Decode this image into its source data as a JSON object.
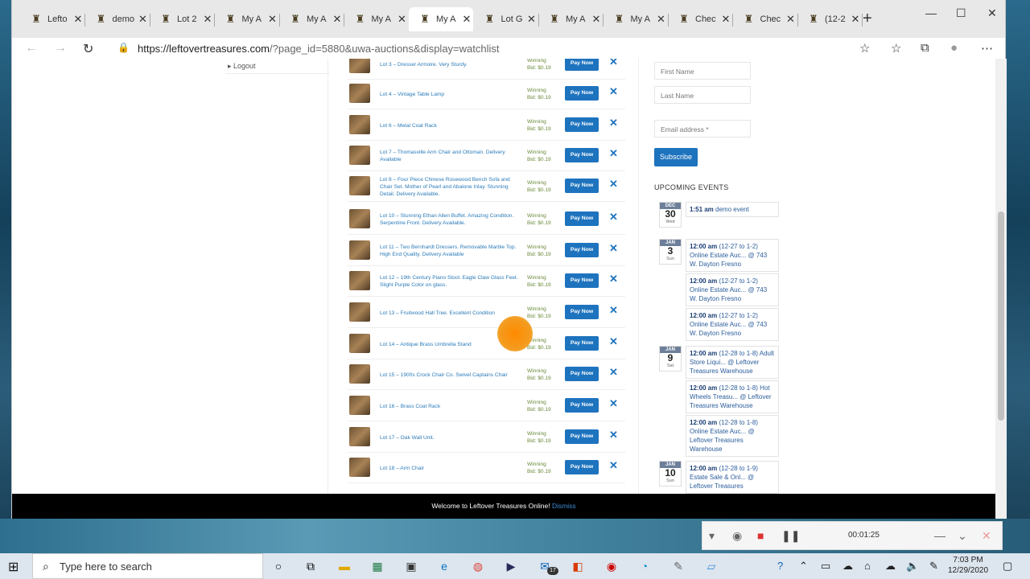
{
  "browser": {
    "tabs": [
      {
        "label": "Lefto",
        "active": false
      },
      {
        "label": "demo",
        "active": false
      },
      {
        "label": "Lot 2",
        "active": false
      },
      {
        "label": "My A",
        "active": false
      },
      {
        "label": "My A",
        "active": false
      },
      {
        "label": "My A",
        "active": false
      },
      {
        "label": "My A",
        "active": true
      },
      {
        "label": "Lot G",
        "active": false
      },
      {
        "label": "My A",
        "active": false
      },
      {
        "label": "My A",
        "active": false
      },
      {
        "label": "Chec",
        "active": false
      },
      {
        "label": "Chec",
        "active": false
      },
      {
        "label": "(12-2",
        "active": false
      }
    ],
    "url_host": "https://leftovertreasures.com",
    "url_path": "/?page_id=5880&uwa-auctions&display=watchlist"
  },
  "sidebar": {
    "logout_label": "Logout"
  },
  "watchlist": {
    "status_label": "Winning",
    "bid_label": "Bid: $0.19",
    "pay_label": "Pay Now",
    "remove_icon": "close-icon",
    "items": [
      {
        "title": "Lot 3 – Dresser Armoire. Very Sturdy."
      },
      {
        "title": "Lot 4 – Vintage Table Lamp"
      },
      {
        "title": "Lot 6 – Metal Coat Rack"
      },
      {
        "title": "Lot 7 – Thomasville Arm Chair and Ottoman. Delivery Available"
      },
      {
        "title": "Lot 8 – Four Piece Chinese Rosewood Bench Sofa and Chair Set. Mother of Pearl and Abalone Inlay. Stunning Detail. Delivery Available."
      },
      {
        "title": "Lot 10 – Stunning Ethan Allen Buffet. Amazing Condition. Serpentine Front. Delivery Available."
      },
      {
        "title": "Lot 11 – Two Bernhardt Dressers. Removable Marble Top. High End Quality. Delivery Available"
      },
      {
        "title": "Lot 12 – 19th Century Piano Stool. Eagle Claw Glass Feet. Slight Purple Color on glass."
      },
      {
        "title": "Lot 13 – Fruitwood Hall Tree. Excellent Condition"
      },
      {
        "title": "Lot 14 – Antique Brass Umbrella Stand"
      },
      {
        "title": "Lot 15 – 1900s Crock Chair Co. Swivel Captains Chair"
      },
      {
        "title": "Lot 16 – Brass Coat Rack"
      },
      {
        "title": "Lot 17 – Oak Wall Unit."
      },
      {
        "title": "Lot 18 – Arm Chair"
      }
    ]
  },
  "newsletter": {
    "first_name_placeholder": "First Name",
    "last_name_placeholder": "Last Name",
    "email_placeholder": "Email address *",
    "subscribe_label": "Subscribe"
  },
  "events": {
    "heading": "UPCOMING EVENTS",
    "days": [
      {
        "month": "DEC",
        "day": "30",
        "weekday": "Wed",
        "entries": [
          {
            "time": "1:51 am",
            "text": "demo event"
          }
        ]
      },
      {
        "month": "JAN",
        "day": "3",
        "weekday": "Sun",
        "entries": [
          {
            "time": "12:00 am",
            "text": "(12-27 to 1-2) Online Estate Auc... @ 743 W. Dayton Fresno"
          },
          {
            "time": "12:00 am",
            "text": "(12-27 to 1-2) Online Estate Auc... @ 743 W. Dayton Fresno"
          },
          {
            "time": "12:00 am",
            "text": "(12-27 to 1-2) Online Estate Auc... @ 743 W. Dayton Fresno"
          }
        ]
      },
      {
        "month": "JAN",
        "day": "9",
        "weekday": "Sat",
        "entries": [
          {
            "time": "12:00 am",
            "text": "(12-28 to 1-8) Adult Store Liqui... @ Leftover Treasures Warehouse"
          },
          {
            "time": "12:00 am",
            "text": "(12-28 to 1-8) Hot Wheels Treasu... @ Leftover Treasures Warehouse"
          },
          {
            "time": "12:00 am",
            "text": "(12-28 to 1-8) Online Estate Auc... @ Leftover Treasures Warehouse"
          }
        ]
      },
      {
        "month": "JAN",
        "day": "10",
        "weekday": "Sun",
        "entries": [
          {
            "time": "12:00 am",
            "text": "(12-28 to 1-9) Estate Sale & Onl... @ Leftover Treasures"
          }
        ]
      }
    ]
  },
  "notice": {
    "text": "Welcome to Leftover Treasures Online!",
    "dismiss": "Dismiss"
  },
  "recorder": {
    "elapsed": "00:01:25"
  },
  "taskbar": {
    "search_placeholder": "Type here to search",
    "badge_count": "17",
    "time": "7:03 PM",
    "date": "12/29/2020"
  },
  "colors": {
    "accent": "#1e73be",
    "winning": "#6a8a3a",
    "link": "#2b7bb9"
  }
}
